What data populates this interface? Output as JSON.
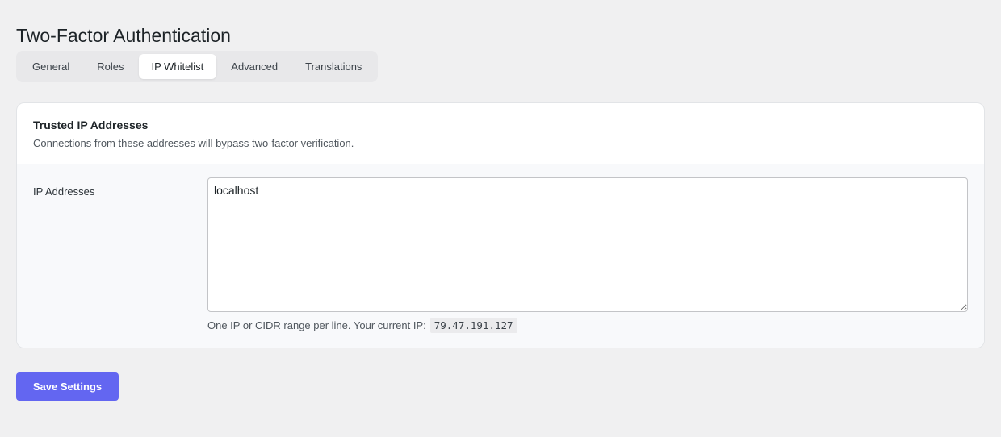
{
  "page": {
    "title": "Two-Factor Authentication"
  },
  "tabs": [
    {
      "label": "General",
      "active": false
    },
    {
      "label": "Roles",
      "active": false
    },
    {
      "label": "IP Whitelist",
      "active": true
    },
    {
      "label": "Advanced",
      "active": false
    },
    {
      "label": "Translations",
      "active": false
    }
  ],
  "card": {
    "title": "Trusted IP Addresses",
    "description": "Connections from these addresses will bypass two-factor verification.",
    "field_label": "IP Addresses",
    "textarea_value": "localhost",
    "help_text": "One IP or CIDR range per line. Your current IP:",
    "current_ip": "79.47.191.127"
  },
  "actions": {
    "save_label": "Save Settings"
  },
  "colors": {
    "accent": "#6366f1",
    "background": "#f0f0f1",
    "card_background": "#ffffff",
    "card_body_background": "#f8f9fb"
  }
}
